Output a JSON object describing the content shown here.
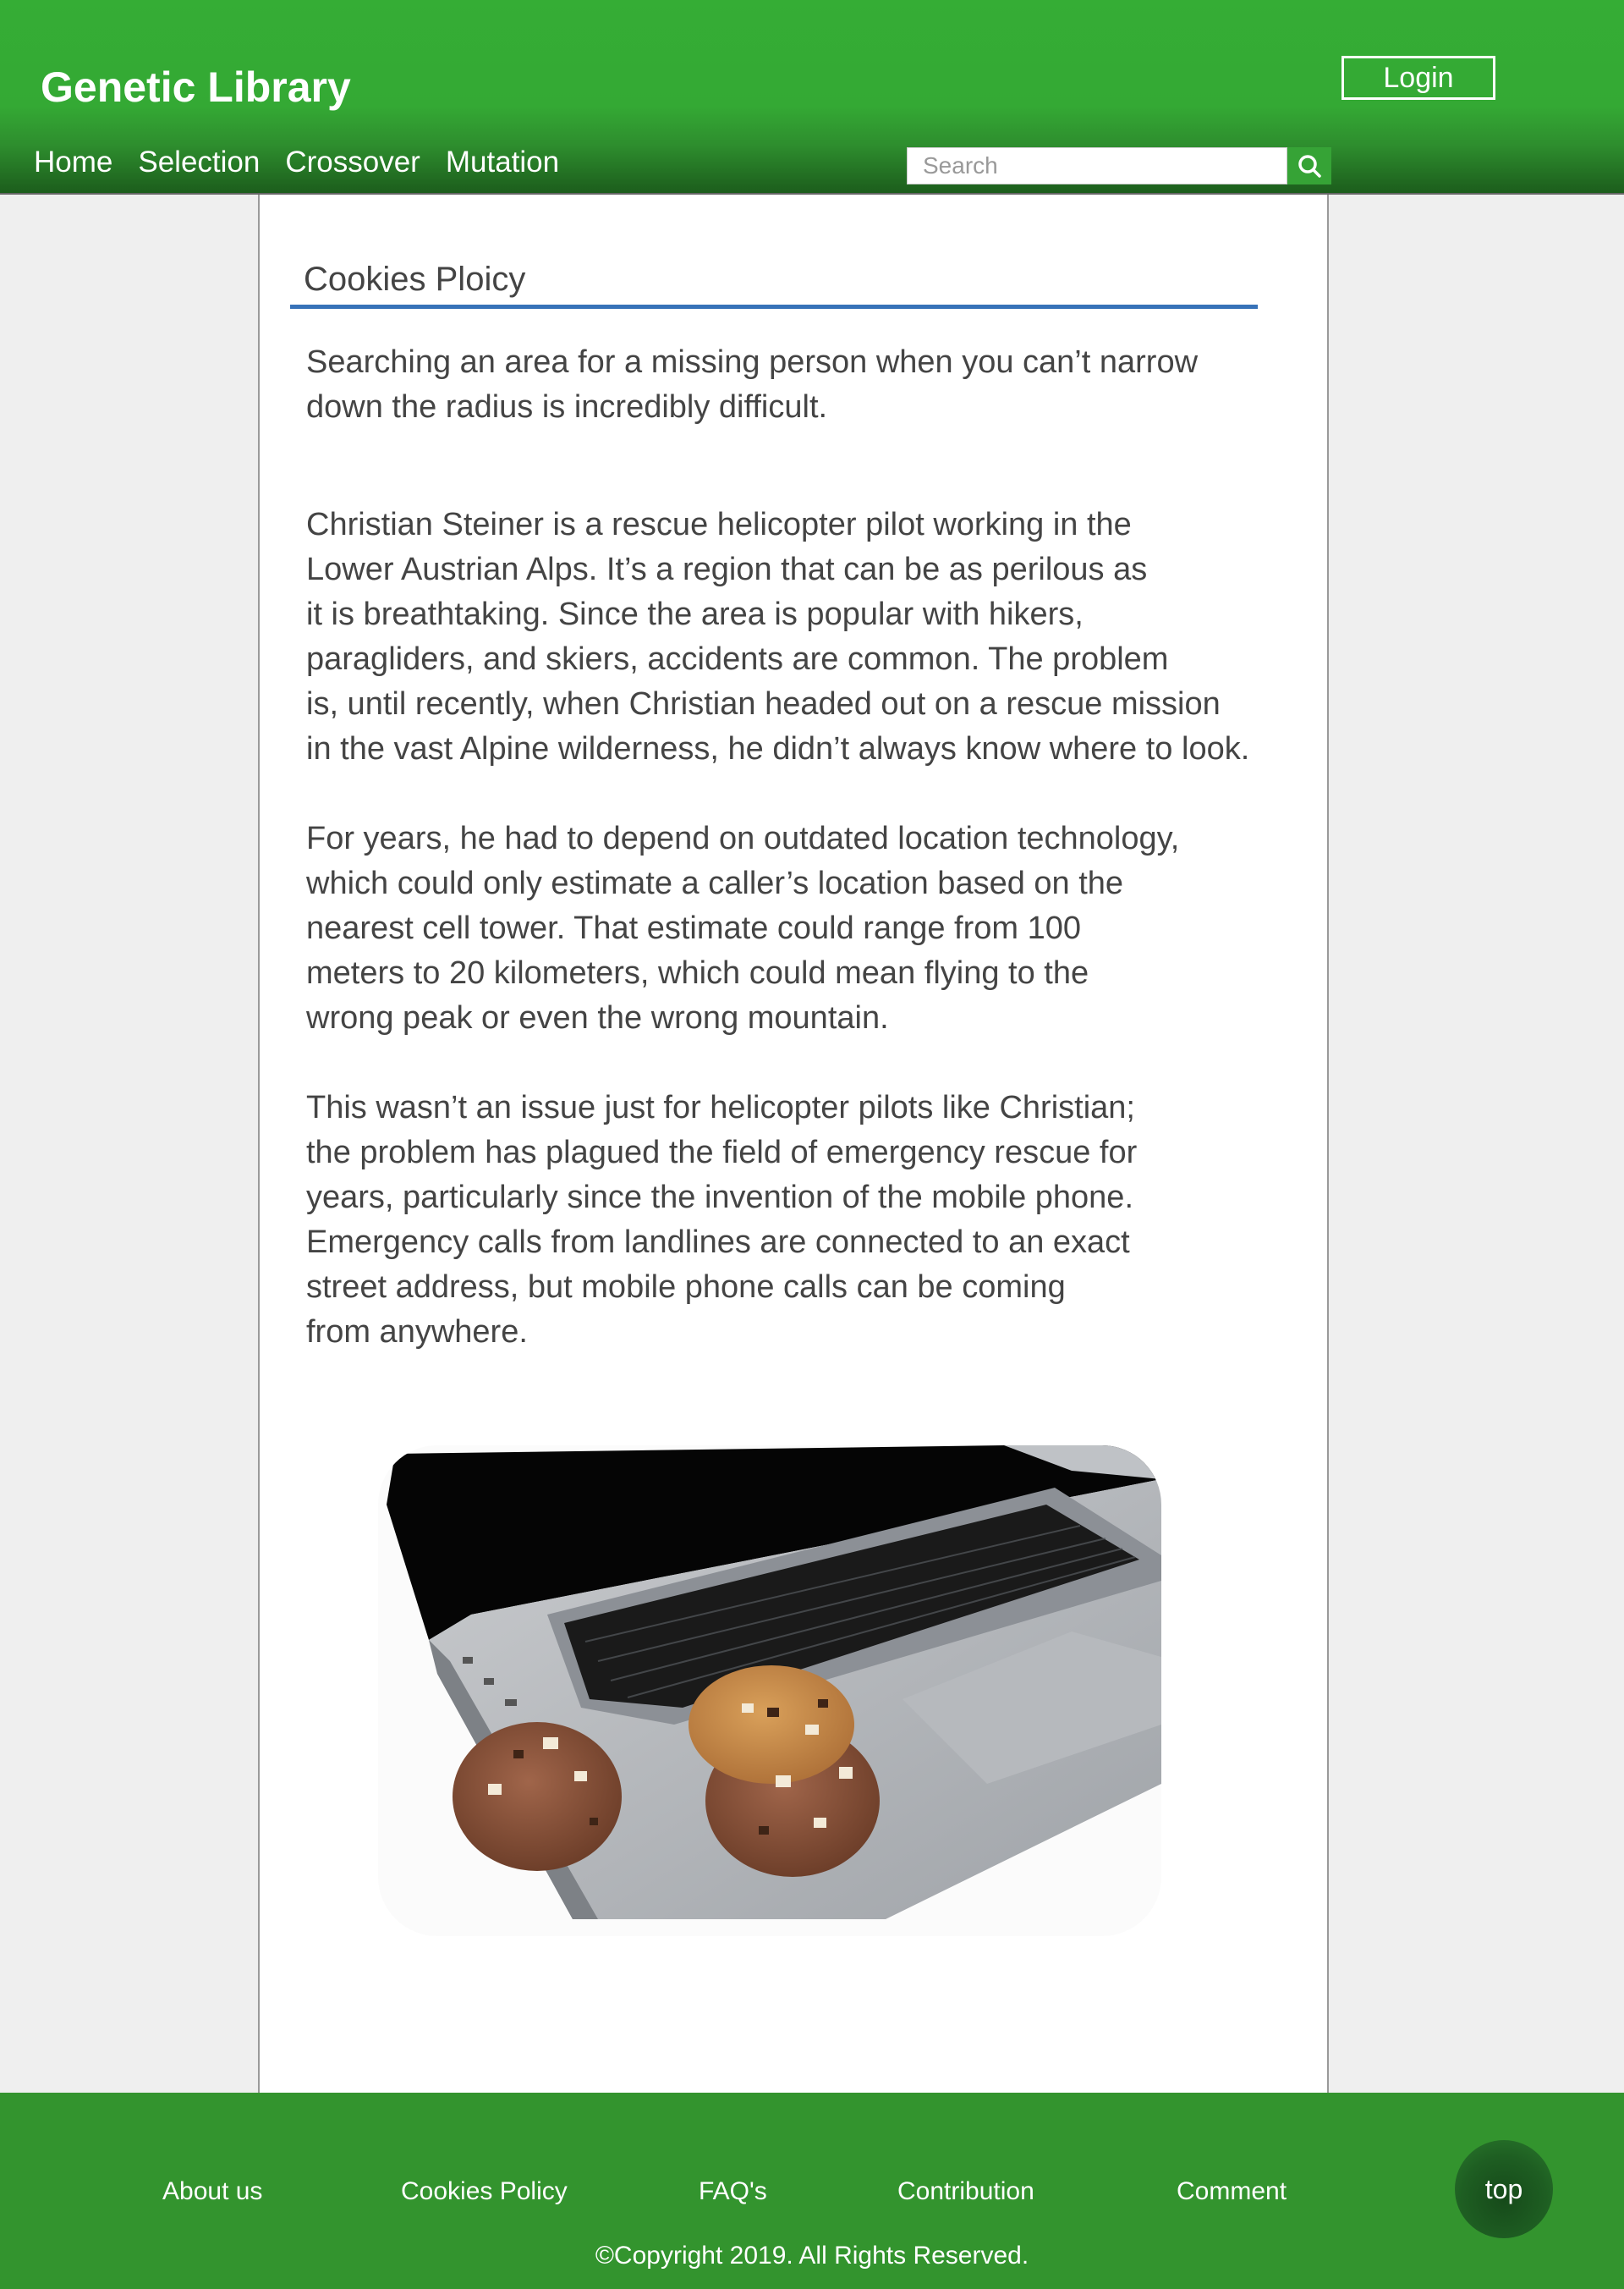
{
  "header": {
    "site_title": "Genetic Library",
    "login_label": "Login",
    "nav": [
      {
        "label": "Home"
      },
      {
        "label": "Selection"
      },
      {
        "label": "Crossover"
      },
      {
        "label": "Mutation"
      }
    ],
    "search_placeholder": "Search",
    "search_icon": "search-icon",
    "brand_color": "#35ad35"
  },
  "main": {
    "heading": "Cookies Ploicy",
    "heading_rule_color": "#3772b8",
    "paragraphs": [
      "Searching an area for a missing person when you can’t narrow\ndown the radius is incredibly difficult.",
      "Christian Steiner is a rescue helicopter pilot working in the\nLower Austrian Alps. It’s a region that can be as perilous as\nit is breathtaking. Since the area is popular with hikers,\nparagliders, and skiers, accidents are common. The problem\nis, until recently, when Christian headed out on a rescue mission\n in the vast Alpine wilderness, he didn’t always know where to look.",
      "For years, he had to depend on outdated location technology,\nwhich could only estimate a caller’s location based on the\nnearest cell tower. That estimate could range from 100\nmeters to 20 kilometers, which could mean flying to the\n wrong peak or even the wrong mountain.",
      "This wasn’t an issue just for helicopter pilots like Christian;\nthe problem has plagued the field of emergency rescue for\nyears, particularly since the invention of the mobile phone.\nEmergency calls from landlines are connected to an exact\nstreet address, but mobile phone calls can be coming\nfrom anywhere."
    ],
    "image_subject": "laptop-with-cookies"
  },
  "footer": {
    "links": [
      {
        "label": "About us"
      },
      {
        "label": "Cookies Policy"
      },
      {
        "label": "FAQ's"
      },
      {
        "label": "Contribution"
      },
      {
        "label": "Comment"
      }
    ],
    "copyright": "©Copyright 2019. All Rights Reserved.",
    "top_label": "top",
    "footer_color": "#33942e"
  }
}
